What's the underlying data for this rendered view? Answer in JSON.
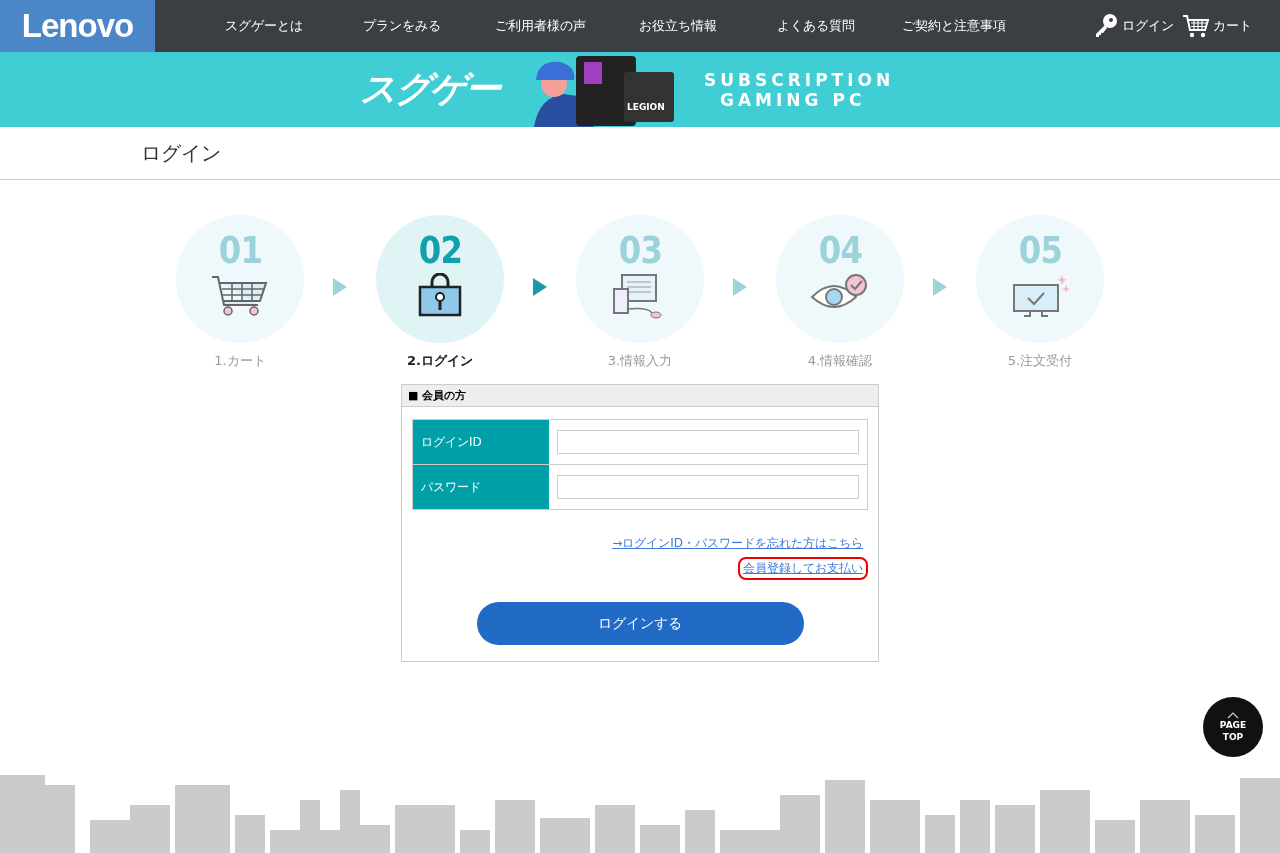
{
  "header": {
    "logo": "Lenovo",
    "nav": [
      "スグゲーとは",
      "プランをみる",
      "ご利用者様の声",
      "お役立ち情報",
      "よくある質問",
      "ご契約と注意事項"
    ],
    "login": "ログイン",
    "cart": "カート"
  },
  "banner": {
    "title": "スグゲー",
    "backpack_label": "LEGION",
    "tagline_1": "SUBSCRIPTION",
    "tagline_2": "GAMING PC"
  },
  "page_title": "ログイン",
  "steps": [
    {
      "number": "01",
      "label": "1.カート",
      "kind": "cart",
      "selected": false
    },
    {
      "number": "02",
      "label": "2.ログイン",
      "kind": "lock",
      "selected": true
    },
    {
      "number": "03",
      "label": "3.情報入力",
      "kind": "computer",
      "selected": false
    },
    {
      "number": "04",
      "label": "4.情報確認",
      "kind": "eye",
      "selected": false
    },
    {
      "number": "05",
      "label": "5.注文受付",
      "kind": "monitor",
      "selected": false
    }
  ],
  "member_form": {
    "heading": "■ 会員の方",
    "fields": [
      {
        "label": "ログインID"
      },
      {
        "label": "パスワード"
      }
    ],
    "links": [
      {
        "text": "→ログインID・パスワードを忘れた方はこちら",
        "highlighted": false
      },
      {
        "text": "会員登録してお支払い",
        "highlighted": true
      }
    ],
    "submit": "ログインする"
  },
  "page_top": {
    "line_1": "PAGE",
    "line_2": "TOP"
  }
}
